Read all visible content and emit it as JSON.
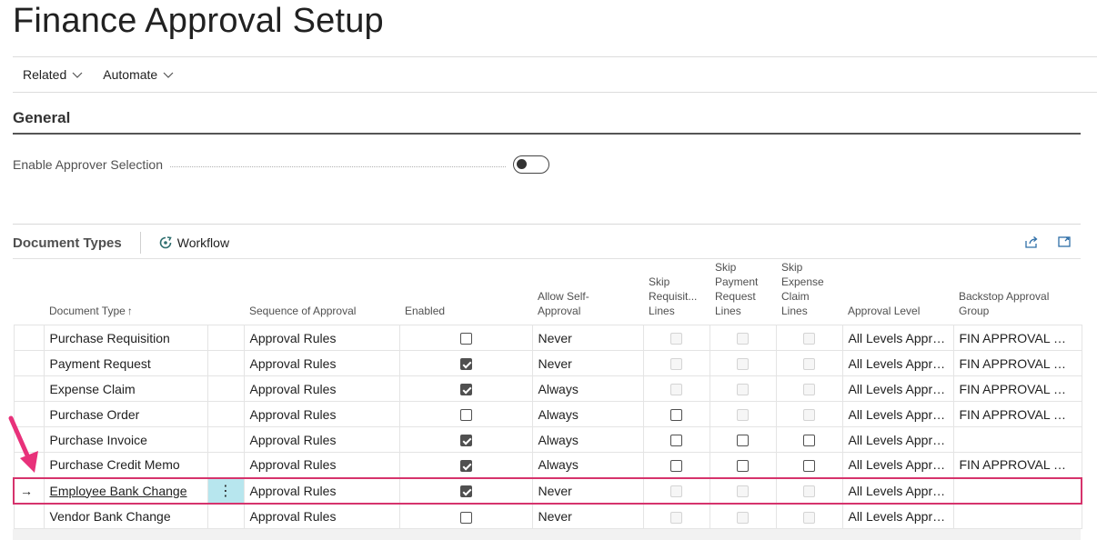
{
  "page": {
    "title": "Finance Approval Setup"
  },
  "actions": [
    {
      "label": "Related"
    },
    {
      "label": "Automate"
    }
  ],
  "general": {
    "title": "General",
    "enable_approver_selection": {
      "label": "Enable Approver Selection",
      "value": false
    }
  },
  "document_types": {
    "title": "Document Types",
    "workflow_label": "Workflow",
    "columns": {
      "document_type": "Document Type",
      "sequence": "Sequence of Approval",
      "enabled": "Enabled",
      "allow_self_1": "Allow Self-",
      "allow_self_2": "Approval",
      "skip_req_1": "Skip",
      "skip_req_2": "Requisit...",
      "skip_req_3": "Lines",
      "skip_pay_1": "Skip",
      "skip_pay_2": "Payment",
      "skip_pay_3": "Request",
      "skip_pay_4": "Lines",
      "skip_exp_1": "Skip",
      "skip_exp_2": "Expense",
      "skip_exp_3": "Claim",
      "skip_exp_4": "Lines",
      "approval_level": "Approval Level",
      "backstop_1": "Backstop Approval",
      "backstop_2": "Group"
    },
    "sort_indicator": "↑",
    "row_indicator": "→",
    "row_menu": "⋮",
    "rows": [
      {
        "document_type": "Purchase Requisition",
        "sequence": "Approval Rules",
        "enabled": false,
        "allow_self": "Never",
        "skip_req": {
          "checked": false,
          "disabled": true
        },
        "skip_pay": {
          "checked": false,
          "disabled": true
        },
        "skip_exp": {
          "checked": false,
          "disabled": true
        },
        "approval_level": "All Levels Appro...",
        "backstop": "FIN APPROVAL GR..."
      },
      {
        "document_type": "Payment Request",
        "sequence": "Approval Rules",
        "enabled": true,
        "allow_self": "Never",
        "skip_req": {
          "checked": false,
          "disabled": true
        },
        "skip_pay": {
          "checked": false,
          "disabled": true
        },
        "skip_exp": {
          "checked": false,
          "disabled": true
        },
        "approval_level": "All Levels Appro...",
        "backstop": "FIN APPROVAL GR..."
      },
      {
        "document_type": "Expense Claim",
        "sequence": "Approval Rules",
        "enabled": true,
        "allow_self": "Always",
        "skip_req": {
          "checked": false,
          "disabled": true
        },
        "skip_pay": {
          "checked": false,
          "disabled": true
        },
        "skip_exp": {
          "checked": false,
          "disabled": true
        },
        "approval_level": "All Levels Appro...",
        "backstop": "FIN APPROVAL GR..."
      },
      {
        "document_type": "Purchase Order",
        "sequence": "Approval Rules",
        "enabled": false,
        "allow_self": "Always",
        "skip_req": {
          "checked": false,
          "disabled": false
        },
        "skip_pay": {
          "checked": false,
          "disabled": true
        },
        "skip_exp": {
          "checked": false,
          "disabled": true
        },
        "approval_level": "All Levels Appro...",
        "backstop": "FIN APPROVAL GR..."
      },
      {
        "document_type": "Purchase Invoice",
        "sequence": "Approval Rules",
        "enabled": true,
        "allow_self": "Always",
        "skip_req": {
          "checked": false,
          "disabled": false
        },
        "skip_pay": {
          "checked": false,
          "disabled": false
        },
        "skip_exp": {
          "checked": false,
          "disabled": false
        },
        "approval_level": "All Levels Appro...",
        "backstop": ""
      },
      {
        "document_type": "Purchase Credit Memo",
        "sequence": "Approval Rules",
        "enabled": true,
        "allow_self": "Always",
        "skip_req": {
          "checked": false,
          "disabled": false
        },
        "skip_pay": {
          "checked": false,
          "disabled": false
        },
        "skip_exp": {
          "checked": false,
          "disabled": false
        },
        "approval_level": "All Levels Appro...",
        "backstop": "FIN APPROVAL GR..."
      },
      {
        "document_type": "Employee Bank Change",
        "sequence": "Approval Rules",
        "enabled": true,
        "allow_self": "Never",
        "skip_req": {
          "checked": false,
          "disabled": true
        },
        "skip_pay": {
          "checked": false,
          "disabled": true
        },
        "skip_exp": {
          "checked": false,
          "disabled": true
        },
        "approval_level": "All Levels Appro...",
        "backstop": "",
        "selected": true
      },
      {
        "document_type": "Vendor Bank Change",
        "sequence": "Approval Rules",
        "enabled": false,
        "allow_self": "Never",
        "skip_req": {
          "checked": false,
          "disabled": true
        },
        "skip_pay": {
          "checked": false,
          "disabled": true
        },
        "skip_exp": {
          "checked": false,
          "disabled": true
        },
        "approval_level": "All Levels Appro...",
        "backstop": ""
      }
    ]
  },
  "colors": {
    "accent": "#d6336c",
    "selected_cell": "#b7e6ee",
    "text": "#212121"
  },
  "icons": [
    "chevron-down-icon",
    "workflow-icon",
    "share-icon",
    "expand-icon",
    "checkbox-icon",
    "annotation-arrow-icon"
  ]
}
